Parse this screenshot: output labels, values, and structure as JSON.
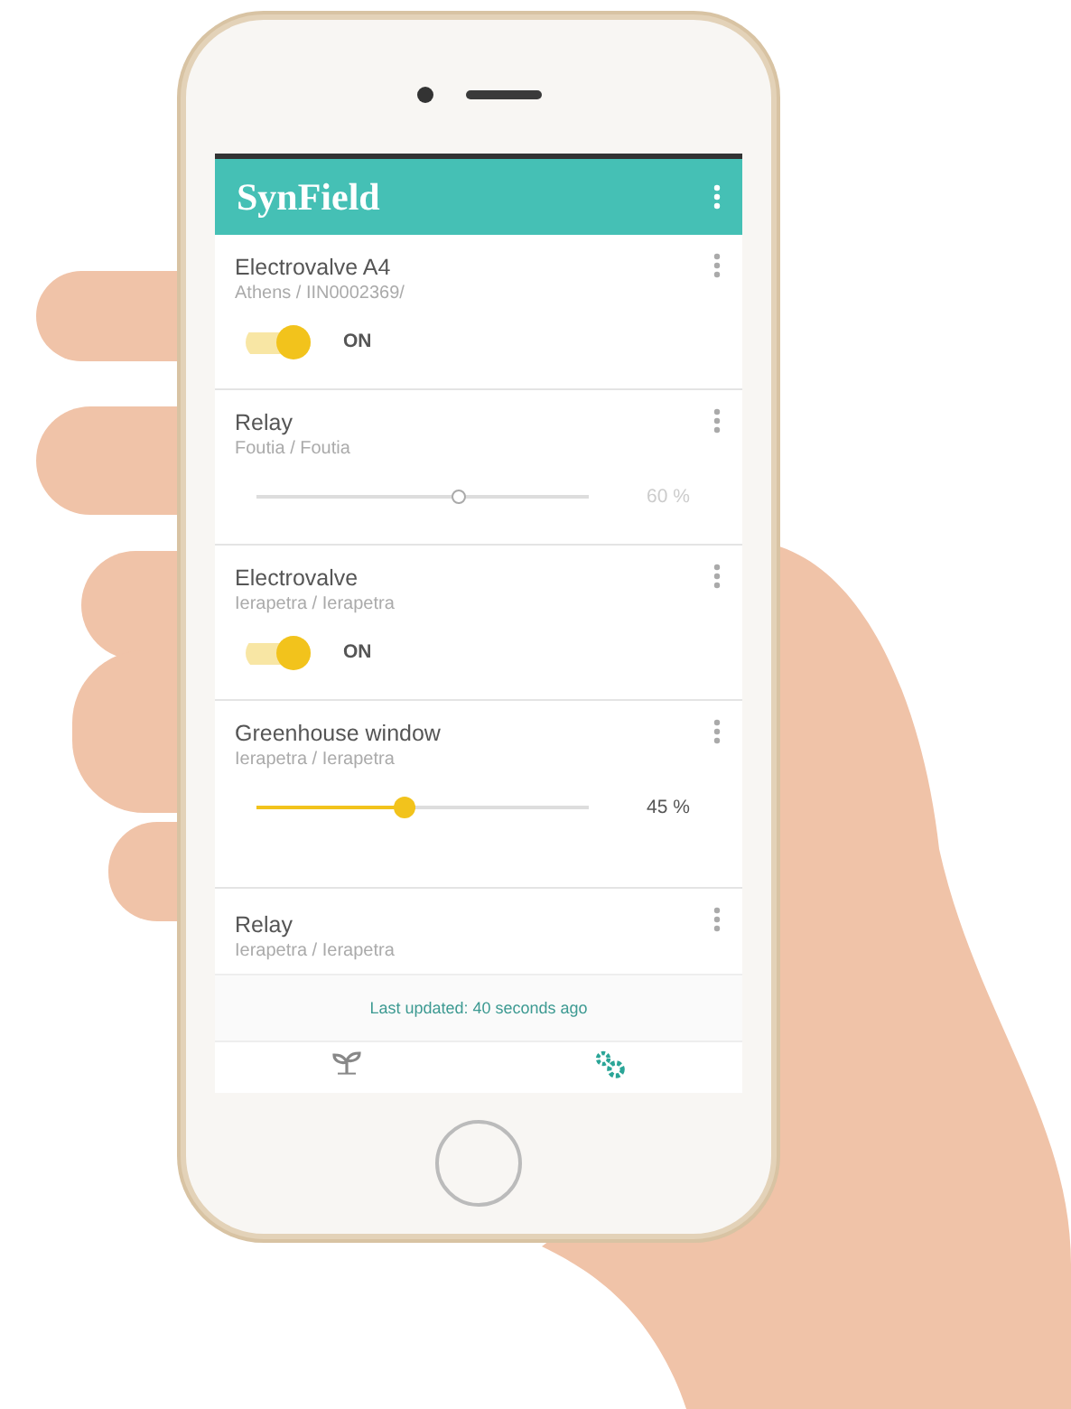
{
  "app_bar": {
    "title": "SynField"
  },
  "devices": [
    {
      "kind": "switch",
      "name": "Electrovalve A4",
      "location": "Athens / IIN0002369/",
      "on": true,
      "state_label": "ON"
    },
    {
      "kind": "slider",
      "name": "Relay",
      "location": "Foutia / Foutia",
      "disabled": true,
      "level": 0.6,
      "reading": "60 %"
    },
    {
      "kind": "switch",
      "name": "Electrovalve",
      "location": "Ierapetra / Ierapetra",
      "on": true,
      "state_label": "ON"
    },
    {
      "kind": "slider",
      "name": "Greenhouse window",
      "location": "Ierapetra / Ierapetra",
      "disabled": false,
      "level": 0.45,
      "reading": "45 %"
    },
    {
      "kind": "plain",
      "name": "Relay",
      "location": "Ierapetra / Ierapetra"
    }
  ],
  "status": "Last updated: 40 seconds ago",
  "bottom_nav": [
    {
      "selected": false
    },
    {
      "selected": true
    }
  ]
}
